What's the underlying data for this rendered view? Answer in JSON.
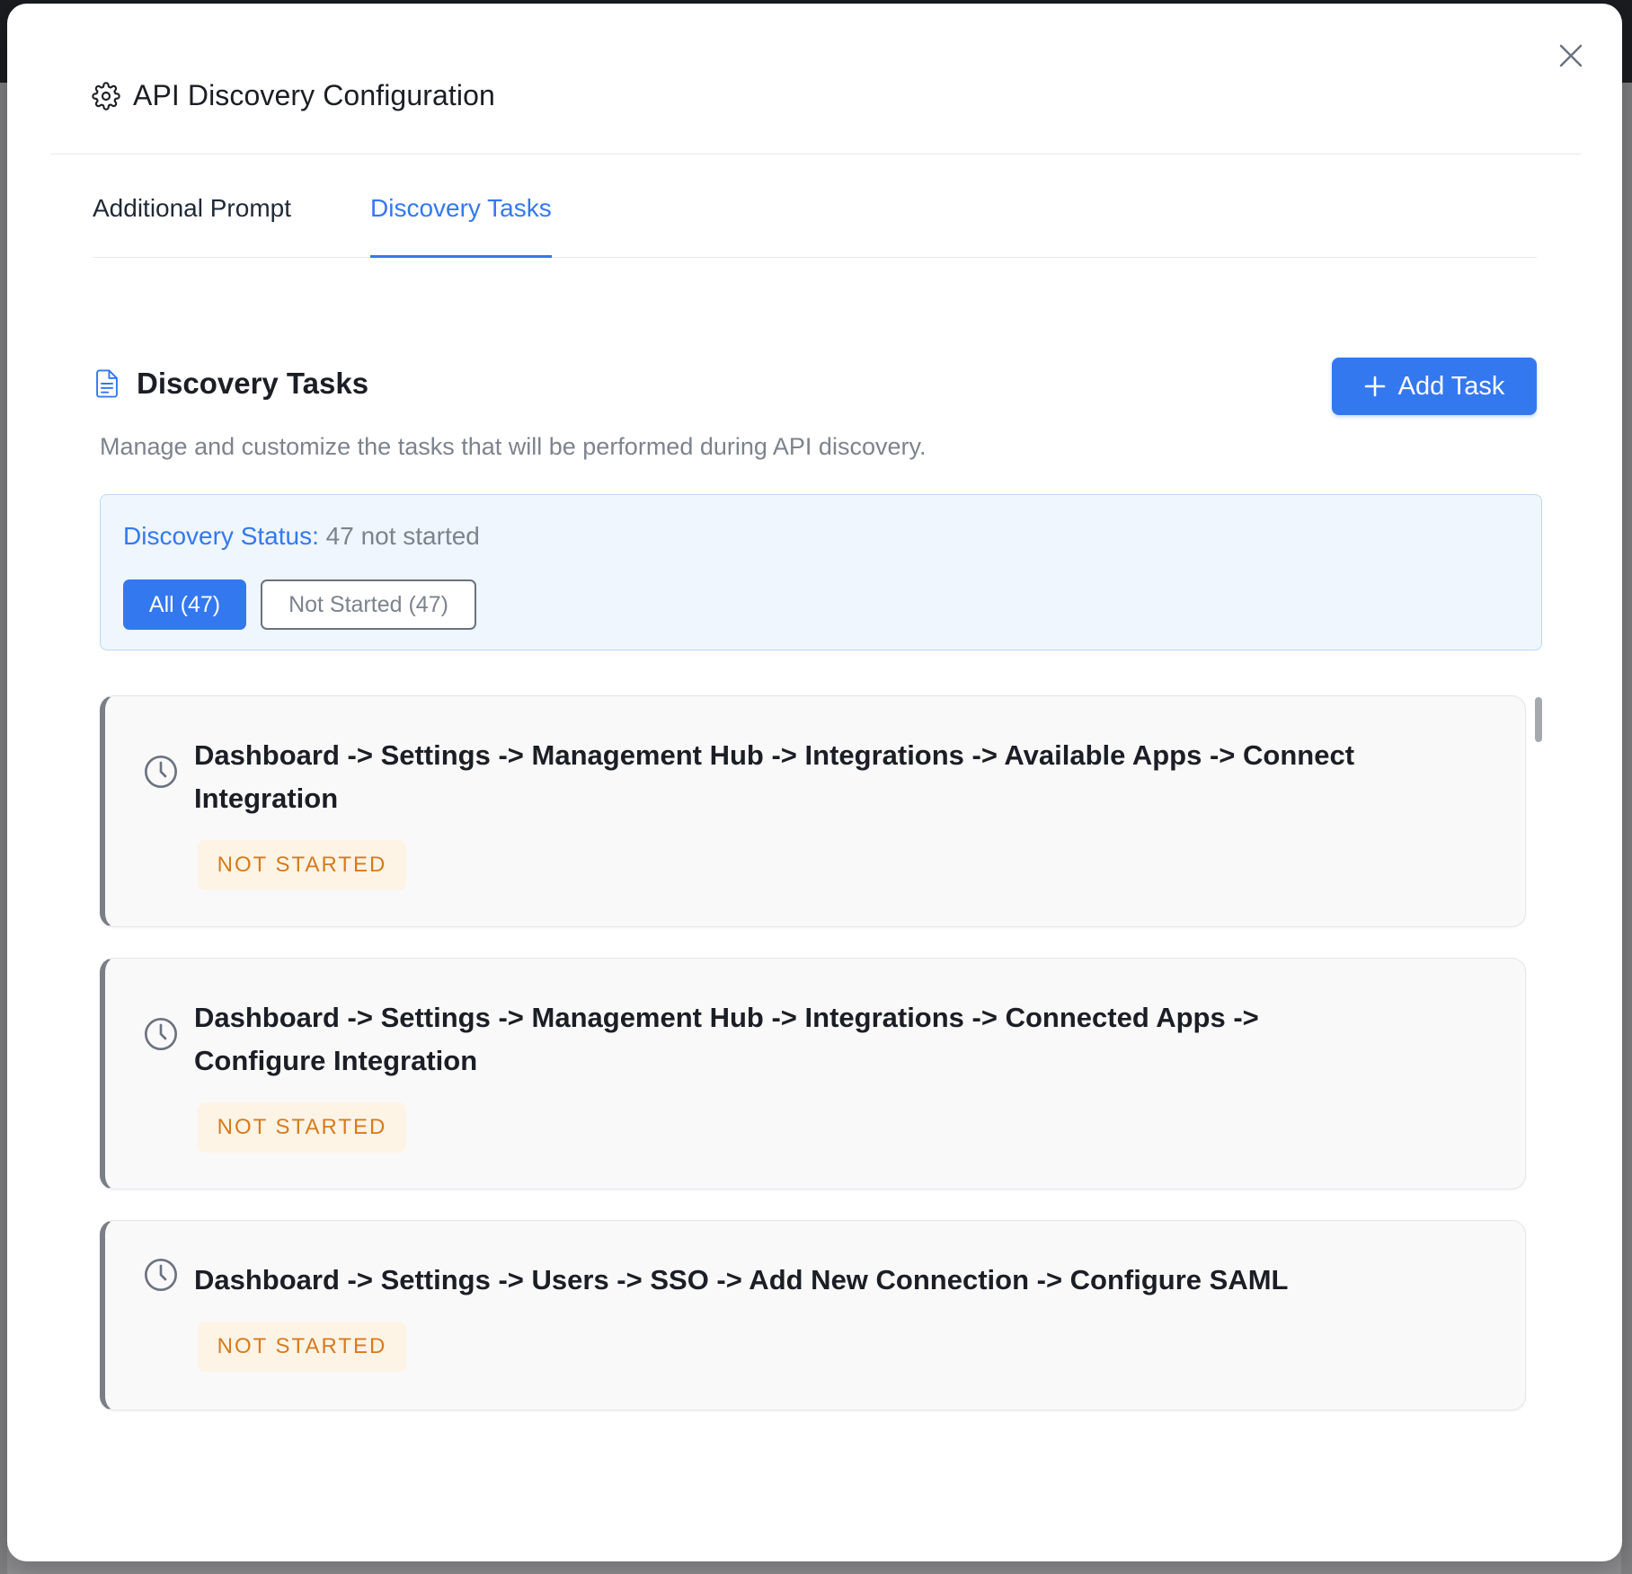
{
  "dialog": {
    "title": "API Discovery Configuration",
    "close_icon": "close-icon",
    "header_icon": "gear-icon"
  },
  "tabs": [
    {
      "label": "Additional Prompt",
      "active": false
    },
    {
      "label": "Discovery Tasks",
      "active": true
    }
  ],
  "section": {
    "icon": "document-icon",
    "title": "Discovery Tasks",
    "add_button_label": "Add Task",
    "description": "Manage and customize the tasks that will be performed during API discovery."
  },
  "status": {
    "label": "Discovery Status:",
    "value": "47 not started",
    "filters": [
      {
        "label": "All (47)",
        "active": true
      },
      {
        "label": "Not Started (47)",
        "active": false
      }
    ]
  },
  "tasks": [
    {
      "title": "Dashboard -> Settings -> Management Hub -> Integrations -> Available Apps -> Connect Integration",
      "status": "NOT STARTED",
      "icon": "clock-icon"
    },
    {
      "title": "Dashboard -> Settings -> Management Hub -> Integrations -> Connected Apps -> Configure Integration",
      "status": "NOT STARTED",
      "icon": "clock-icon"
    },
    {
      "title": "Dashboard -> Settings -> Users -> SSO -> Add New Connection -> Configure SAML",
      "status": "NOT STARTED",
      "icon": "clock-icon"
    }
  ],
  "colors": {
    "accent": "#3478f0",
    "badge_bg": "#fdf4e6",
    "badge_text": "#d77a1c",
    "status_panel_bg": "#eff6fe"
  }
}
